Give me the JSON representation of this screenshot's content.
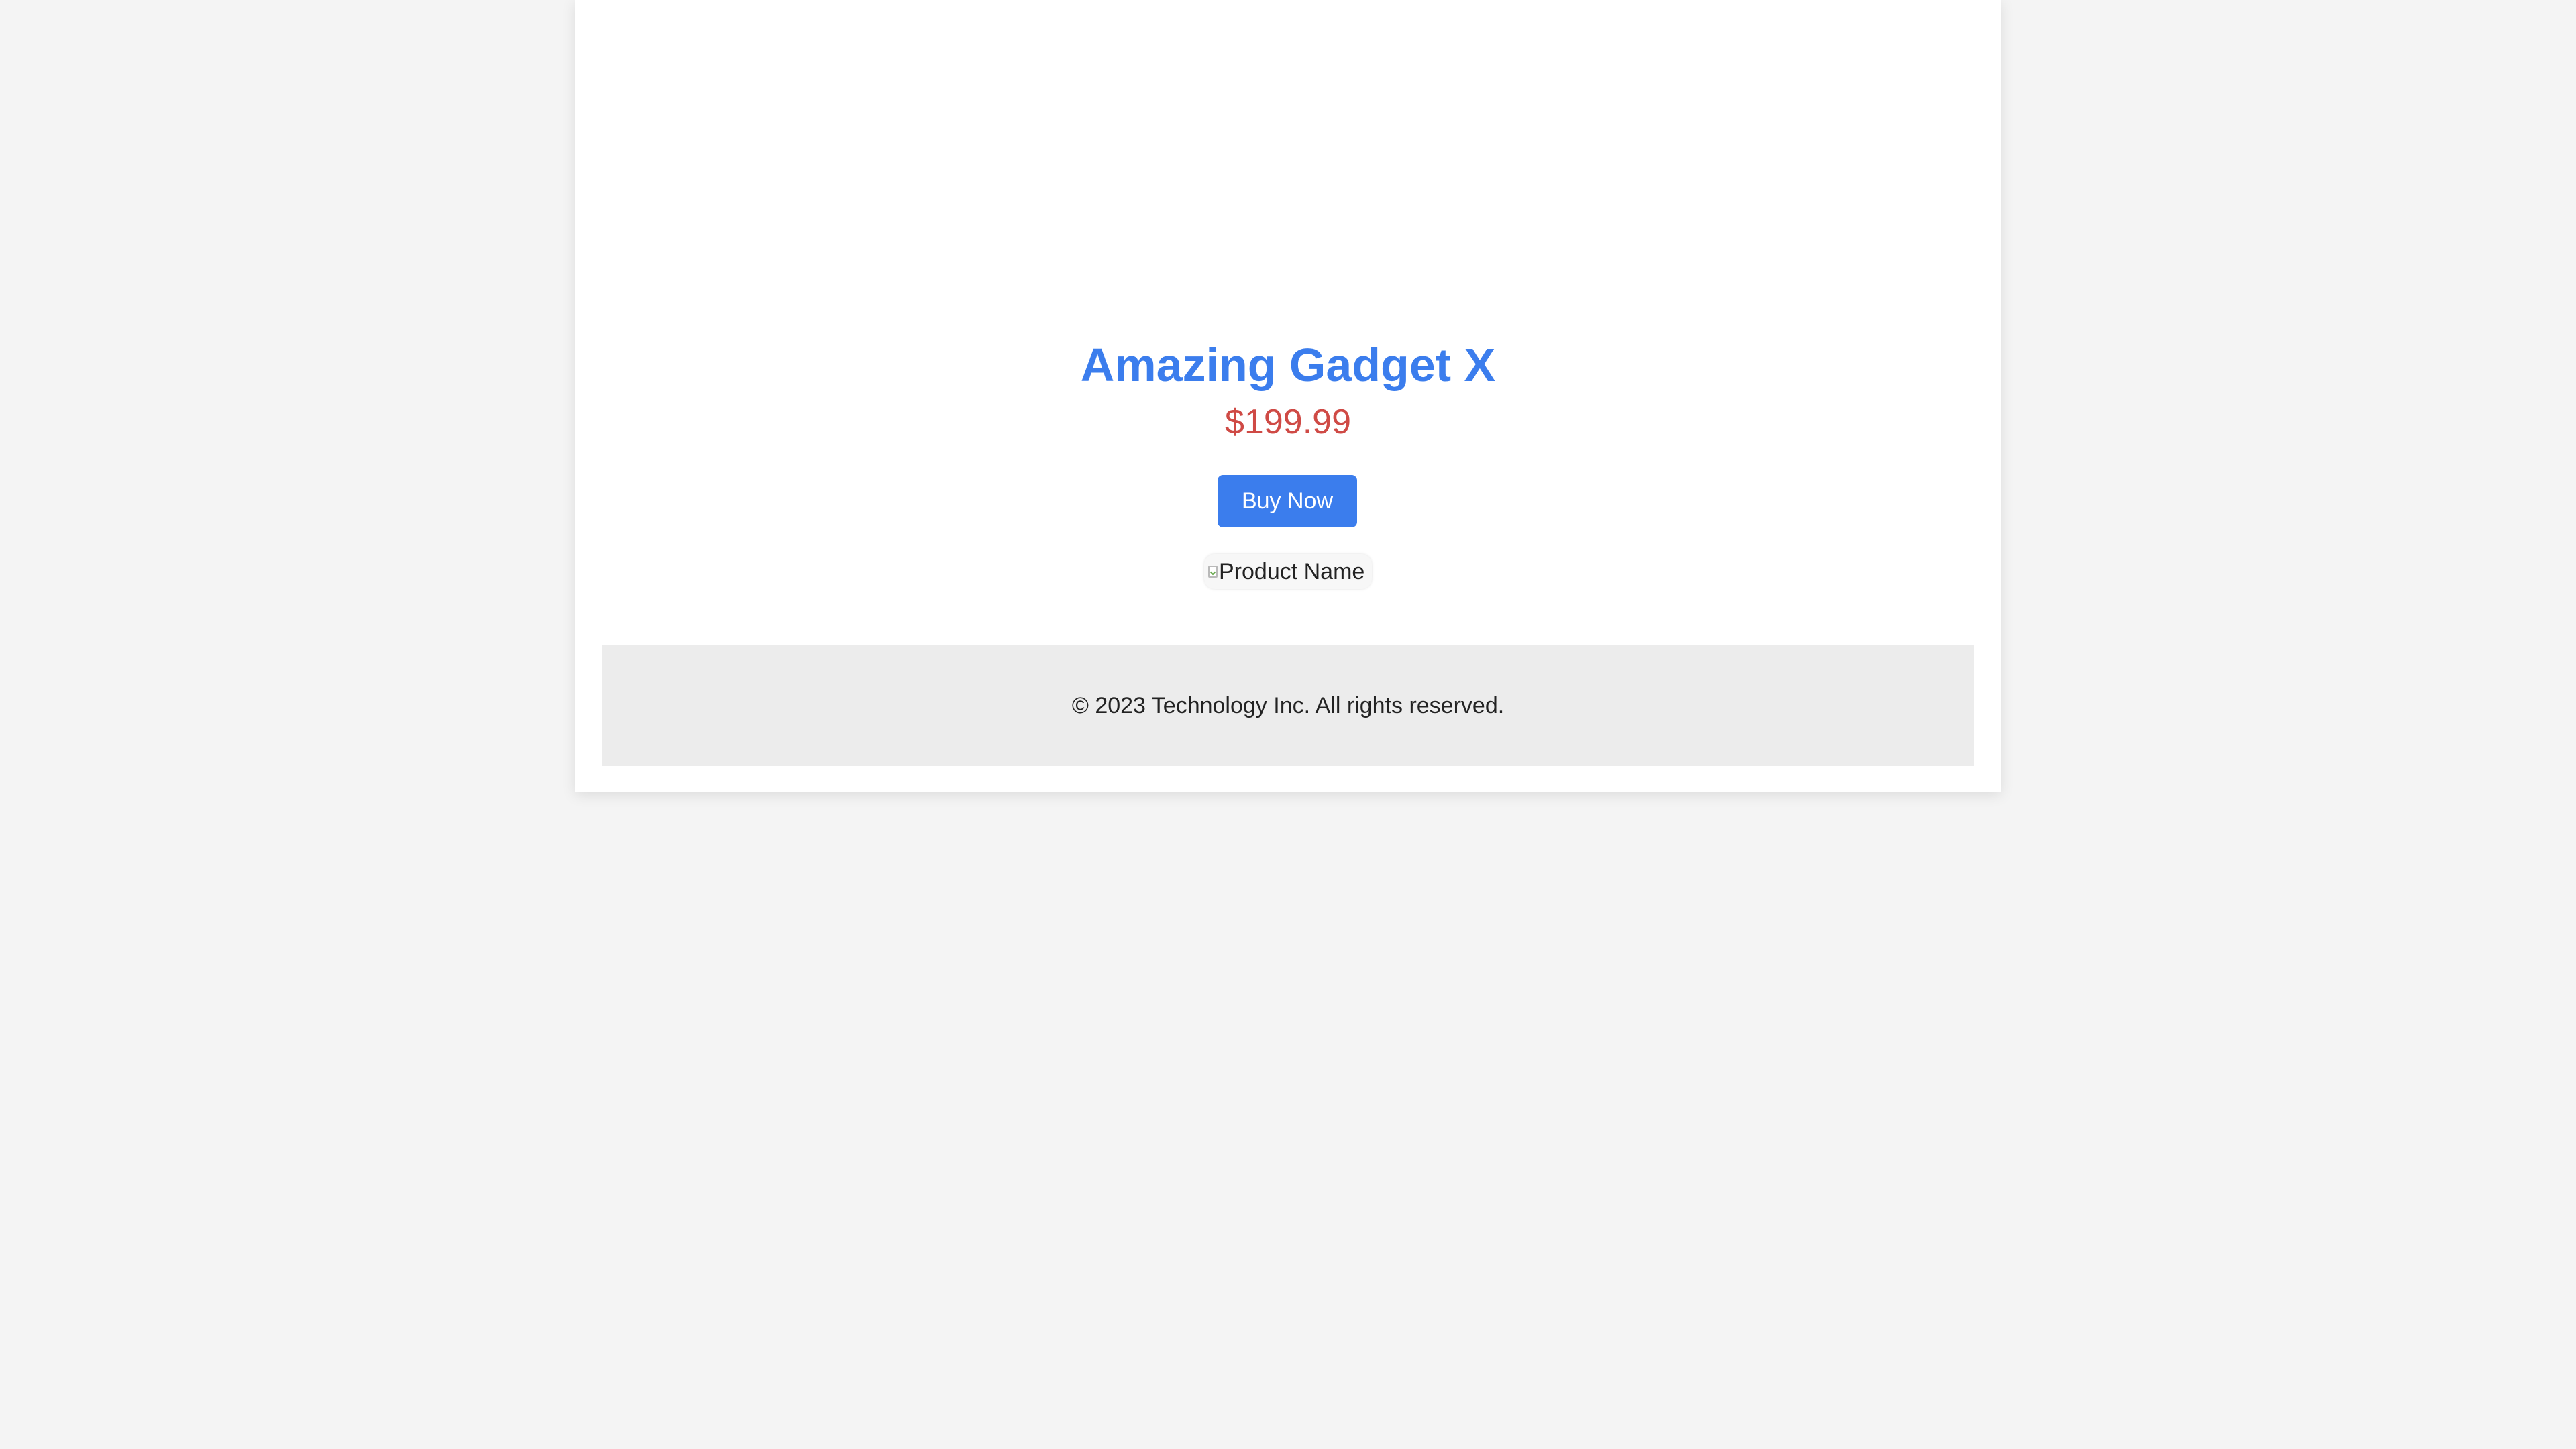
{
  "product": {
    "title": "Amazing Gadget X",
    "price": "$199.99",
    "buy_label": "Buy Now",
    "image_alt": "Product Name"
  },
  "footer": {
    "text": "© 2023 Technology Inc. All rights reserved."
  },
  "colors": {
    "page_background": "#f4f4f4",
    "card_background": "#ffffff",
    "accent": "#3b7ded",
    "price": "#cf4a45",
    "footer_background": "#ececec"
  },
  "icons": {
    "broken_image": "broken-image-icon"
  }
}
